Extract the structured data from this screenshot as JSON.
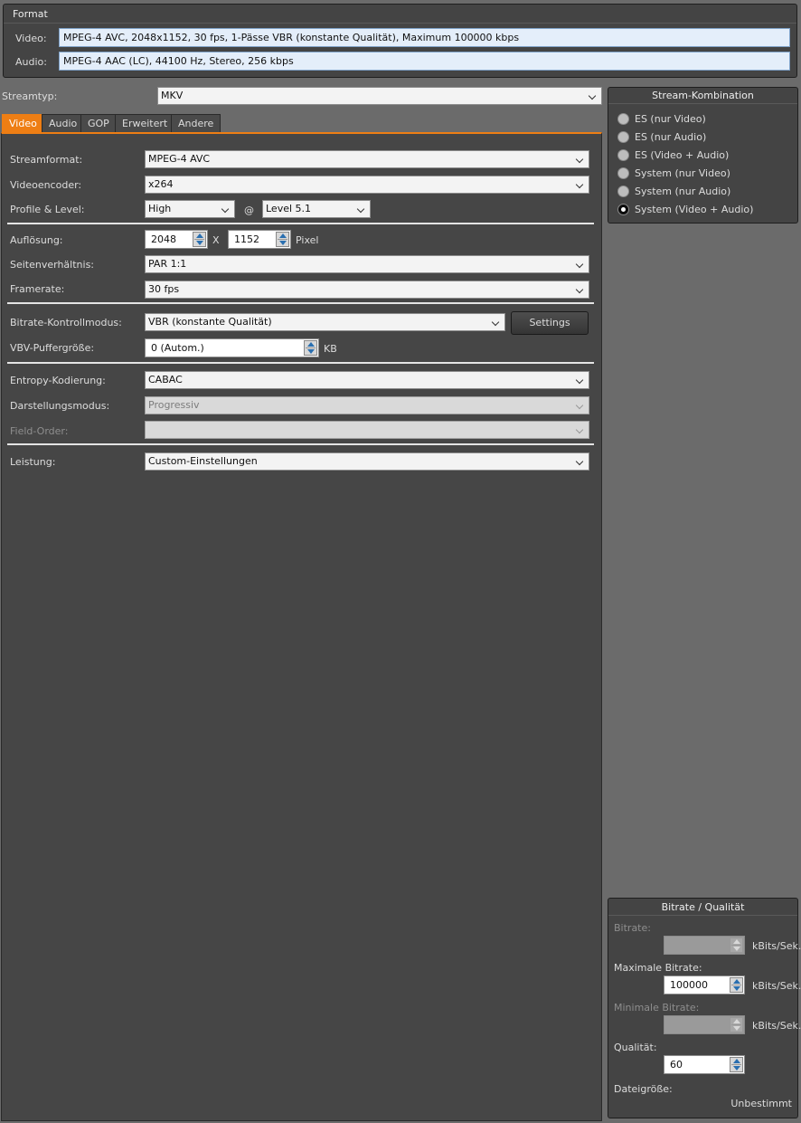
{
  "format": {
    "title": "Format",
    "video_label": "Video:",
    "video_value": "MPEG-4 AVC, 2048x1152, 30 fps, 1-Pässe VBR (konstante Qualität), Maximum 100000 kbps",
    "audio_label": "Audio:",
    "audio_value": "MPEG-4 AAC (LC), 44100 Hz, Stereo, 256 kbps"
  },
  "streamtyp": {
    "label": "Streamtyp:",
    "value": "MKV"
  },
  "tabs": [
    {
      "label": "Video",
      "active": true
    },
    {
      "label": "Audio",
      "active": false
    },
    {
      "label": "GOP",
      "active": false
    },
    {
      "label": "Erweitert",
      "active": false
    },
    {
      "label": "Andere",
      "active": false
    }
  ],
  "video": {
    "streamformat": {
      "label": "Streamformat:",
      "value": "MPEG-4 AVC"
    },
    "videoencoder": {
      "label": "Videoencoder:",
      "value": "x264"
    },
    "profile": {
      "label": "Profile & Level:",
      "value": "High",
      "at": "@",
      "level": "Level 5.1"
    },
    "aufloesung": {
      "label": "Auflösung:",
      "width": "2048",
      "x": "X",
      "height": "1152",
      "unit": "Pixel"
    },
    "seitenverhaeltnis": {
      "label": "Seitenverhältnis:",
      "value": "PAR 1:1"
    },
    "framerate": {
      "label": "Framerate:",
      "value": "30 fps"
    },
    "bitrate_mode": {
      "label": "Bitrate-Kontrollmodus:",
      "value": "VBR (konstante Qualität)",
      "settings": "Settings"
    },
    "vbv": {
      "label": "VBV-Puffergröße:",
      "value": "0 (Autom.)",
      "unit": "KB"
    },
    "entropy": {
      "label": "Entropy-Kodierung:",
      "value": "CABAC"
    },
    "darstellung": {
      "label": "Darstellungsmodus:",
      "value": "Progressiv"
    },
    "field_order": {
      "label": "Field-Order:",
      "value": ""
    },
    "leistung": {
      "label": "Leistung:",
      "value": "Custom-Einstellungen"
    }
  },
  "stream_kombination": {
    "title": "Stream-Kombination",
    "options": [
      {
        "label": "ES (nur Video)",
        "selected": false
      },
      {
        "label": "ES (nur Audio)",
        "selected": false
      },
      {
        "label": "ES (Video + Audio)",
        "selected": false
      },
      {
        "label": "System (nur Video)",
        "selected": false
      },
      {
        "label": "System (nur Audio)",
        "selected": false
      },
      {
        "label": "System (Video + Audio)",
        "selected": true
      }
    ]
  },
  "bitrate_qualitaet": {
    "title": "Bitrate / Qualität",
    "bitrate": {
      "label": "Bitrate:",
      "value": "",
      "unit": "kBits/Sek."
    },
    "max_bitrate": {
      "label": "Maximale Bitrate:",
      "value": "100000",
      "unit": "kBits/Sek."
    },
    "min_bitrate": {
      "label": "Minimale Bitrate:",
      "value": "",
      "unit": "kBits/Sek."
    },
    "qualitaet": {
      "label": "Qualität:",
      "value": "60"
    },
    "dateigroesse": {
      "label": "Dateigröße:",
      "value": "Unbestimmt"
    }
  },
  "colors": {
    "accent": "#ee7e14",
    "panel": "#444444",
    "field_highlight": "#e4eefa"
  },
  "icons": {
    "dropdown": "chevron-down-icon",
    "spinner": "spin-arrows-icon",
    "radio": "radio-icon"
  }
}
